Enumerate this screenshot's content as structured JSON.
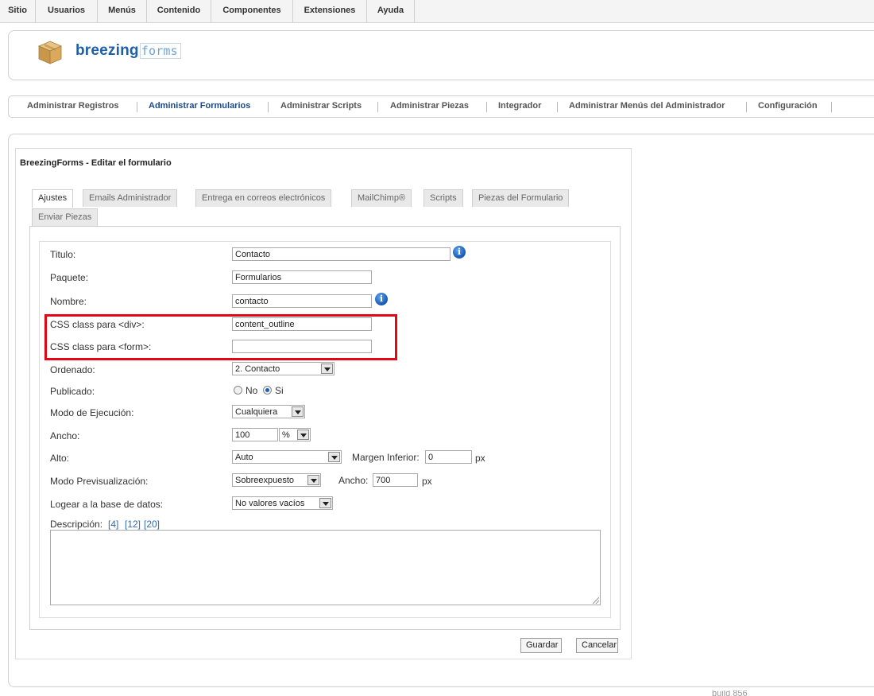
{
  "topmenu": [
    "Sitio",
    "Usuarios",
    "Menús",
    "Contenido",
    "Componentes",
    "Extensiones",
    "Ayuda"
  ],
  "logo": {
    "bold": "breezing",
    "light": "forms"
  },
  "submenu": {
    "items": [
      "Administrar Registros",
      "Administrar Formularios",
      "Administrar Scripts",
      "Administrar Piezas",
      "Integrador",
      "Administrar Menús del Administrador",
      "Configuración"
    ],
    "active": "Administrar Formularios"
  },
  "form_title": "BreezingForms - Editar el formulario",
  "tabs": [
    "Ajustes",
    "Emails Administrador",
    "Entrega en correos electrónicos",
    "MailChimp®",
    "Scripts",
    "Piezas del Formulario",
    "Enviar Piezas"
  ],
  "active_tab": "Ajustes",
  "fields": {
    "titulo": {
      "label": "Titulo:",
      "value": "Contacto"
    },
    "paquete": {
      "label": "Paquete:",
      "value": "Formularios"
    },
    "nombre": {
      "label": "Nombre:",
      "value": "contacto"
    },
    "css_div": {
      "label": "CSS class para <div>:",
      "value": "content_outline"
    },
    "css_form": {
      "label": "CSS class para <form>:",
      "value": ""
    },
    "ordenado": {
      "label": "Ordenado:",
      "value": "2. Contacto"
    },
    "publicado": {
      "label": "Publicado:",
      "no": "No",
      "si": "Si",
      "selected": "Si"
    },
    "modo_ejecucion": {
      "label": "Modo de Ejecución:",
      "value": "Cualquiera"
    },
    "ancho": {
      "label": "Ancho:",
      "value": "100",
      "unit": "%"
    },
    "alto": {
      "label": "Alto:",
      "value": "Auto",
      "margen_label": "Margen Inferior:",
      "margen_value": "0",
      "margen_unit": "px"
    },
    "modo_previsualizacion": {
      "label": "Modo Previsualización:",
      "value": "Sobreexpuesto",
      "ancho_label": "Ancho:",
      "ancho_value": "700",
      "ancho_unit": "px"
    },
    "logear": {
      "label": "Logear a la base de datos:",
      "value": "No valores vacíos"
    },
    "descripcion": {
      "label": "Descripción:",
      "links": [
        "[4]",
        "[12]",
        "[20]"
      ],
      "value": ""
    }
  },
  "buttons": {
    "save": "Guardar",
    "cancel": "Cancelar"
  },
  "footer": "build 856",
  "colors": {
    "highlight": "#e30613",
    "accent": "#1f5fa8"
  }
}
